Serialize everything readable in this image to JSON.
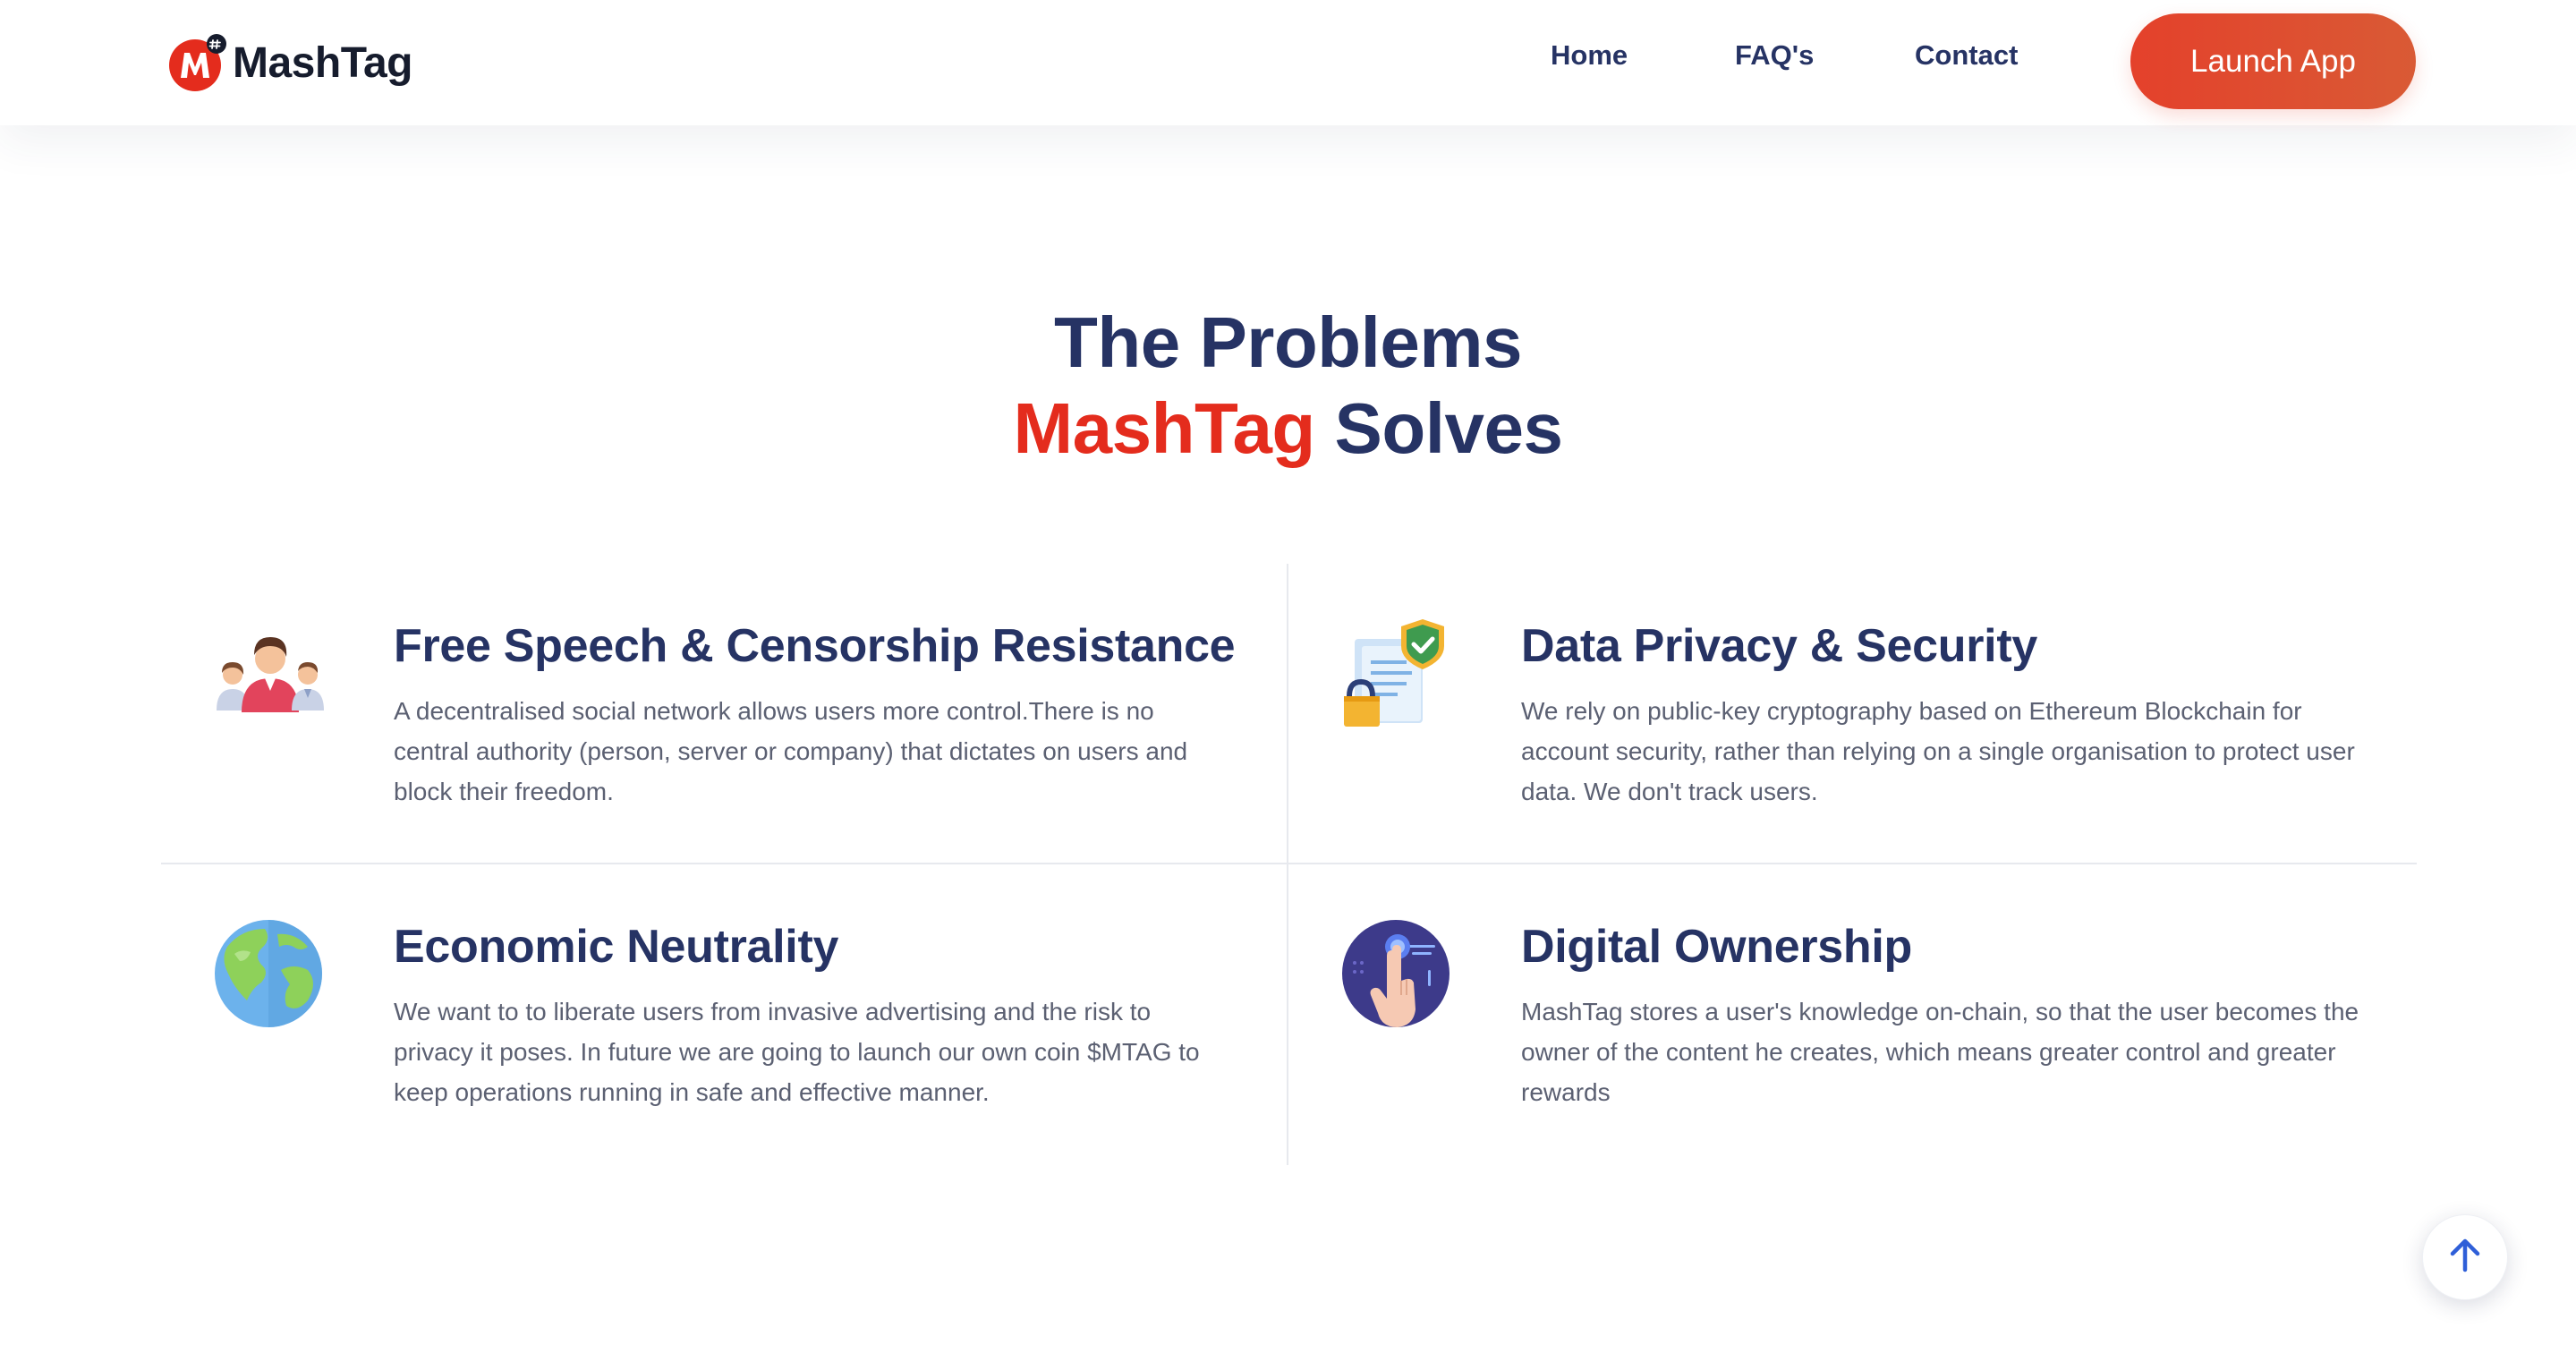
{
  "header": {
    "logo_text": "MashTag",
    "logo_icon": "mashtag-logo-icon",
    "nav": [
      {
        "label": "Home"
      },
      {
        "label": "FAQ's"
      },
      {
        "label": "Contact"
      }
    ],
    "cta_label": "Launch App"
  },
  "section": {
    "title_line1": "The Problems",
    "title_accent": "MashTag",
    "title_rest": "Solves"
  },
  "features": [
    {
      "icon": "people-group-icon",
      "title": "Free Speech & Censorship Resistance",
      "body": "A decentralised social network allows users more control.There is no central authority (person, server or company) that dictates on users and block their freedom."
    },
    {
      "icon": "secure-document-icon",
      "title": "Data Privacy & Security",
      "body": "We rely on public-key cryptography based on Ethereum Blockchain for account security, rather than relying on a single organisation to protect user data. We don't track users."
    },
    {
      "icon": "globe-icon",
      "title": "Economic Neutrality",
      "body": "We want to to liberate users from invasive advertising and the risk to privacy it poses. In future we are going to launch our own coin $MTAG to keep operations running in safe and effective manner."
    },
    {
      "icon": "touch-hand-icon",
      "title": "Digital Ownership",
      "body": "MashTag stores a user's knowledge on-chain, so that the user becomes the owner of the content he creates, which means greater control and greater rewards"
    }
  ],
  "scroll_top_icon": "arrow-up-icon",
  "colors": {
    "brand_red": "#e42c1d",
    "navy": "#263364",
    "body_text": "#5b6072",
    "divider": "#e7e9ee"
  }
}
